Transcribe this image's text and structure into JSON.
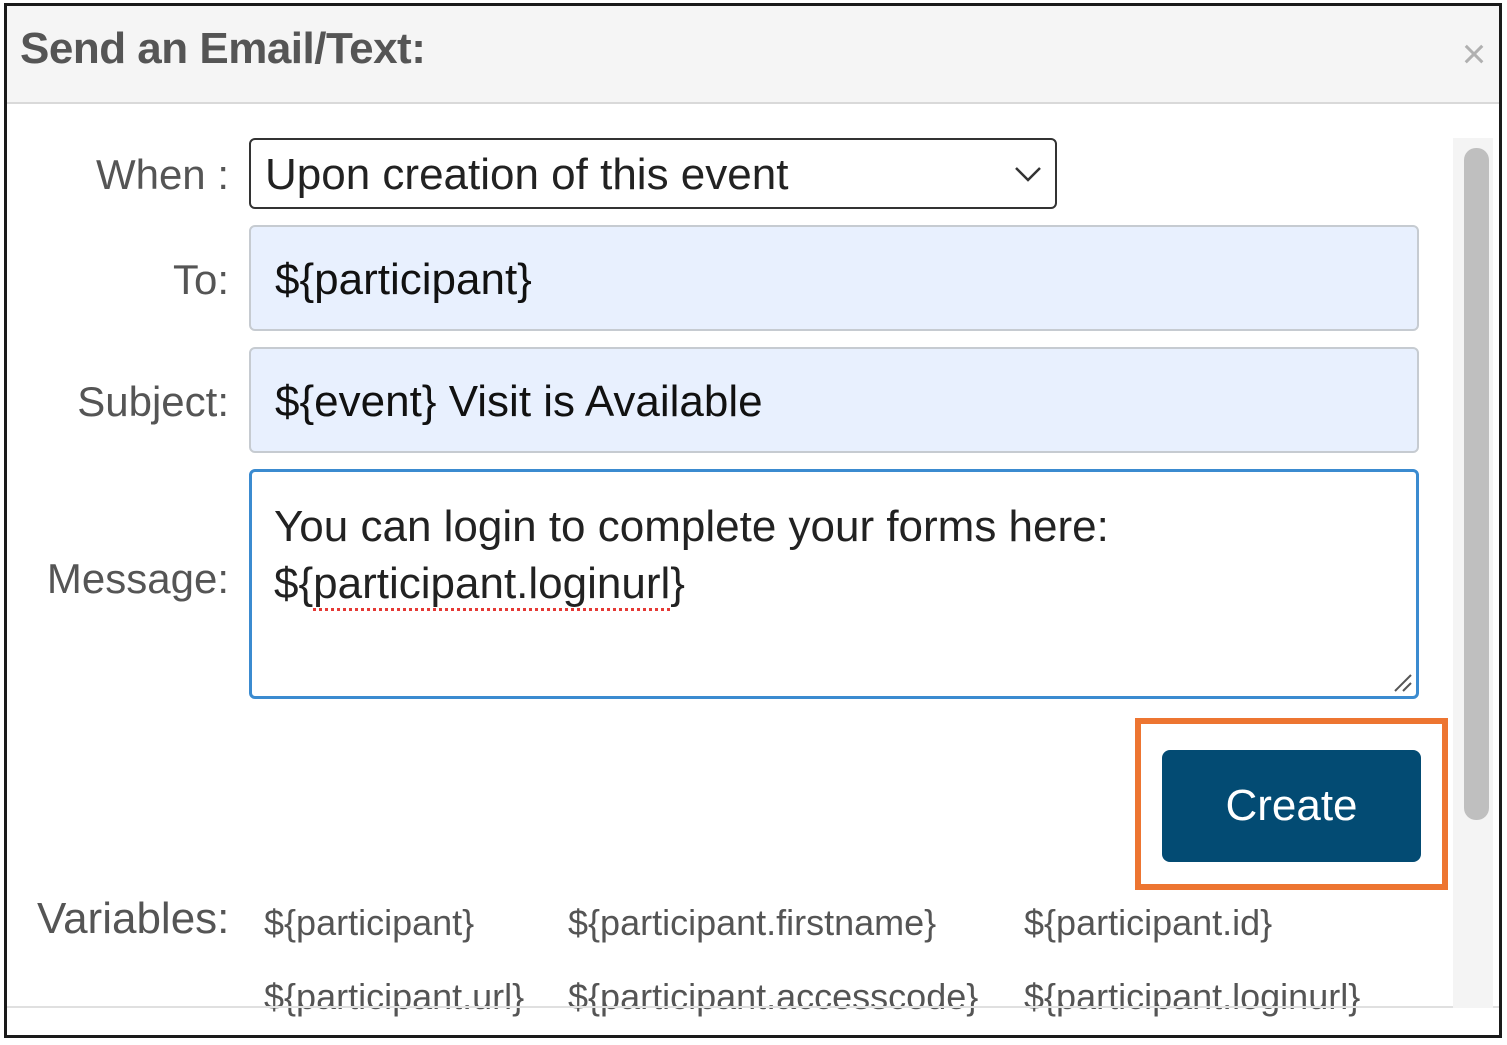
{
  "dialog": {
    "title": "Send an Email/Text:",
    "close_symbol": "×"
  },
  "form": {
    "when_label": "When :",
    "when_value": "Upon creation of this event",
    "to_label": "To:",
    "to_value": "${participant}",
    "subject_label": "Subject:",
    "subject_value": "${event} Visit is Available",
    "message_label": "Message:",
    "message_line1": "You can login to complete your forms here:",
    "message_line2_prefix": "${",
    "message_line2_flagged": "participant.loginurl",
    "message_line2_suffix": "}"
  },
  "actions": {
    "create_label": "Create",
    "highlight_color": "#ed7531",
    "button_color": "#034b73"
  },
  "variables": {
    "label": "Variables:",
    "items": [
      "${participant}",
      "${participant.firstname}",
      "${participant.id}",
      "${participant.url}",
      "${participant.accesscode}",
      "${participant.loginurl}"
    ]
  },
  "icons": {
    "close": "close-icon",
    "dropdown": "chevron-down-icon",
    "resize": "resize-handle-icon"
  }
}
